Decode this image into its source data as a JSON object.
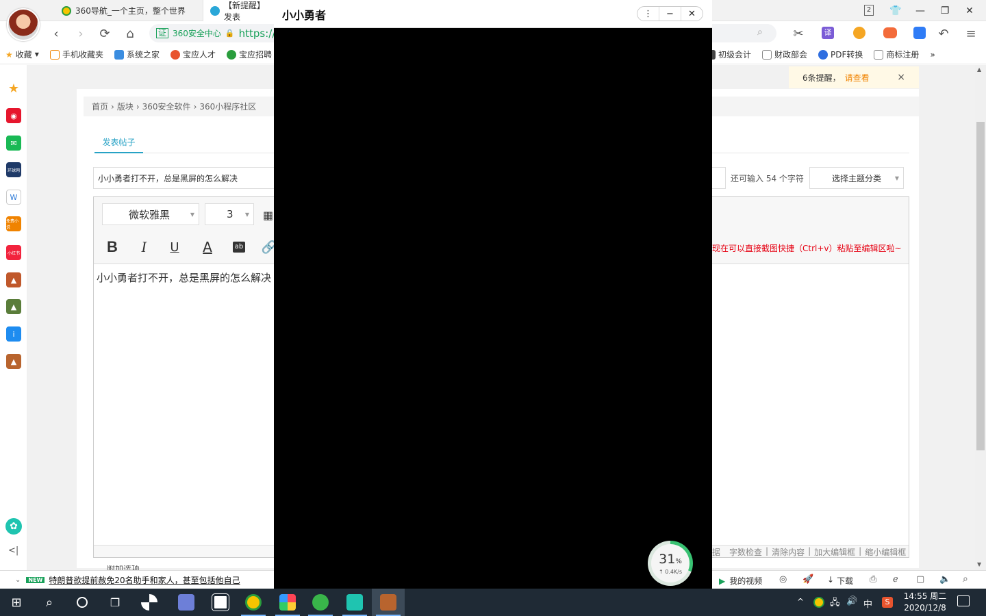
{
  "browser": {
    "tabs": [
      {
        "label": "360导航_一个主页，整个世界"
      },
      {
        "label": "【新提醒】发表"
      }
    ],
    "tab_count": "2",
    "url_cert": "证",
    "url_site": "360安全中心",
    "url_text": "https://b",
    "toolbar_translate": "译"
  },
  "bookmarks": [
    {
      "label": "收藏"
    },
    {
      "label": "手机收藏夹"
    },
    {
      "label": "系统之家"
    },
    {
      "label": "宝应人才"
    },
    {
      "label": "宝应招聘"
    },
    {
      "label": "初级会计"
    },
    {
      "label": "财政部会"
    },
    {
      "label": "PDF转换"
    },
    {
      "label": "商标注册"
    }
  ],
  "bookmarks_more": "»",
  "notice": {
    "text": "6条提醒，",
    "link": "请查看",
    "close": "×"
  },
  "sidebar": {
    "icons": [
      {
        "name": "favorites-star-icon",
        "color": "#f5a623",
        "text": "★"
      },
      {
        "name": "weibo-icon",
        "color": "#e6162d",
        "text": "◉"
      },
      {
        "name": "mail-icon",
        "color": "#19b955",
        "text": "✉"
      },
      {
        "name": "news-icon",
        "color": "#1f3a68",
        "text": "环球网"
      },
      {
        "name": "word-doc-icon",
        "color": "#2b79d7",
        "text": "W"
      },
      {
        "name": "novel-icon",
        "color": "#f08300",
        "text": "免费小说"
      },
      {
        "name": "xiaohongshu-icon",
        "color": "#f2233d",
        "text": "小红书"
      },
      {
        "name": "game-warrior-icon",
        "color": "#c0582b",
        "text": "▲"
      },
      {
        "name": "game-battle-icon",
        "color": "#5a7d3a",
        "text": "▲"
      },
      {
        "name": "ipad-app-icon",
        "color": "#1e8cf0",
        "text": "i"
      },
      {
        "name": "game-hero-icon",
        "color": "#b8642e",
        "text": "▲"
      }
    ],
    "collapse": "<|"
  },
  "page": {
    "breadcrumb": [
      "首页",
      "版块",
      "360安全软件",
      "360小程序社区"
    ],
    "tab_label": "发表帖子",
    "title_value": "小小勇者打不开，总是黑屏的怎么解决",
    "char_counter": "还可输入 54 个字符",
    "category_select": "选择主题分类",
    "font_select": "微软雅黑",
    "size_select": "3",
    "paste_hint": "现在可以直接截图快捷（Ctrl+v）粘贴至编辑区啦~",
    "editor_content": "小小勇者打不开，总是黑屏的怎么解决",
    "footer_links": [
      "据",
      "字数检查",
      "清除内容",
      "加大编辑框",
      "缩小编辑框"
    ],
    "bottom_partial": "附加选项"
  },
  "statusbar": {
    "news": "特朗普欲提前赦免20名助手和家人，甚至包括他自己",
    "new_badge": "NEW",
    "my_video": "我的视频",
    "download": "下载"
  },
  "popup": {
    "title": "小小勇者",
    "speed_percent": "31",
    "percent_sign": "%",
    "speed_rate": "↑ 0.4K/s"
  },
  "taskbar": {
    "time": "14:55 周二",
    "date": "2020/12/8",
    "ime": "中"
  }
}
